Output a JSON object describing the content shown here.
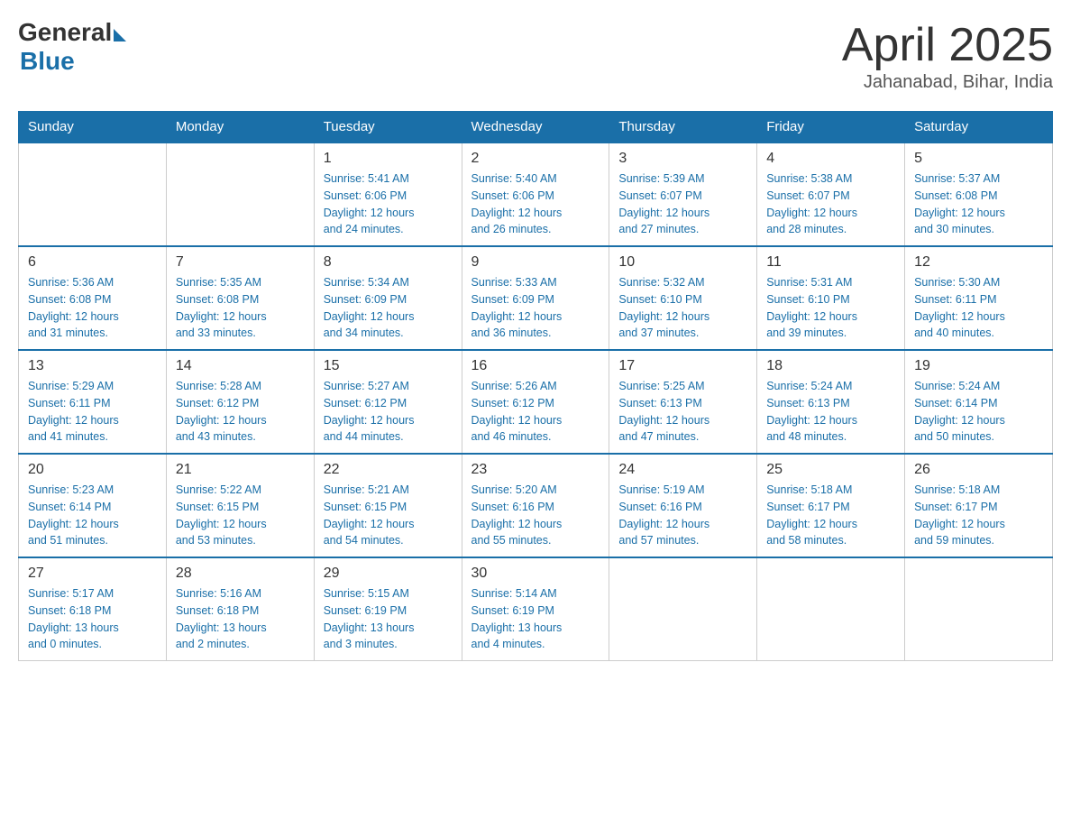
{
  "header": {
    "logo_general": "General",
    "logo_blue": "Blue",
    "month_title": "April 2025",
    "location": "Jahanabad, Bihar, India"
  },
  "weekdays": [
    "Sunday",
    "Monday",
    "Tuesday",
    "Wednesday",
    "Thursday",
    "Friday",
    "Saturday"
  ],
  "weeks": [
    [
      {
        "day": "",
        "info": ""
      },
      {
        "day": "",
        "info": ""
      },
      {
        "day": "1",
        "info": "Sunrise: 5:41 AM\nSunset: 6:06 PM\nDaylight: 12 hours\nand 24 minutes."
      },
      {
        "day": "2",
        "info": "Sunrise: 5:40 AM\nSunset: 6:06 PM\nDaylight: 12 hours\nand 26 minutes."
      },
      {
        "day": "3",
        "info": "Sunrise: 5:39 AM\nSunset: 6:07 PM\nDaylight: 12 hours\nand 27 minutes."
      },
      {
        "day": "4",
        "info": "Sunrise: 5:38 AM\nSunset: 6:07 PM\nDaylight: 12 hours\nand 28 minutes."
      },
      {
        "day": "5",
        "info": "Sunrise: 5:37 AM\nSunset: 6:08 PM\nDaylight: 12 hours\nand 30 minutes."
      }
    ],
    [
      {
        "day": "6",
        "info": "Sunrise: 5:36 AM\nSunset: 6:08 PM\nDaylight: 12 hours\nand 31 minutes."
      },
      {
        "day": "7",
        "info": "Sunrise: 5:35 AM\nSunset: 6:08 PM\nDaylight: 12 hours\nand 33 minutes."
      },
      {
        "day": "8",
        "info": "Sunrise: 5:34 AM\nSunset: 6:09 PM\nDaylight: 12 hours\nand 34 minutes."
      },
      {
        "day": "9",
        "info": "Sunrise: 5:33 AM\nSunset: 6:09 PM\nDaylight: 12 hours\nand 36 minutes."
      },
      {
        "day": "10",
        "info": "Sunrise: 5:32 AM\nSunset: 6:10 PM\nDaylight: 12 hours\nand 37 minutes."
      },
      {
        "day": "11",
        "info": "Sunrise: 5:31 AM\nSunset: 6:10 PM\nDaylight: 12 hours\nand 39 minutes."
      },
      {
        "day": "12",
        "info": "Sunrise: 5:30 AM\nSunset: 6:11 PM\nDaylight: 12 hours\nand 40 minutes."
      }
    ],
    [
      {
        "day": "13",
        "info": "Sunrise: 5:29 AM\nSunset: 6:11 PM\nDaylight: 12 hours\nand 41 minutes."
      },
      {
        "day": "14",
        "info": "Sunrise: 5:28 AM\nSunset: 6:12 PM\nDaylight: 12 hours\nand 43 minutes."
      },
      {
        "day": "15",
        "info": "Sunrise: 5:27 AM\nSunset: 6:12 PM\nDaylight: 12 hours\nand 44 minutes."
      },
      {
        "day": "16",
        "info": "Sunrise: 5:26 AM\nSunset: 6:12 PM\nDaylight: 12 hours\nand 46 minutes."
      },
      {
        "day": "17",
        "info": "Sunrise: 5:25 AM\nSunset: 6:13 PM\nDaylight: 12 hours\nand 47 minutes."
      },
      {
        "day": "18",
        "info": "Sunrise: 5:24 AM\nSunset: 6:13 PM\nDaylight: 12 hours\nand 48 minutes."
      },
      {
        "day": "19",
        "info": "Sunrise: 5:24 AM\nSunset: 6:14 PM\nDaylight: 12 hours\nand 50 minutes."
      }
    ],
    [
      {
        "day": "20",
        "info": "Sunrise: 5:23 AM\nSunset: 6:14 PM\nDaylight: 12 hours\nand 51 minutes."
      },
      {
        "day": "21",
        "info": "Sunrise: 5:22 AM\nSunset: 6:15 PM\nDaylight: 12 hours\nand 53 minutes."
      },
      {
        "day": "22",
        "info": "Sunrise: 5:21 AM\nSunset: 6:15 PM\nDaylight: 12 hours\nand 54 minutes."
      },
      {
        "day": "23",
        "info": "Sunrise: 5:20 AM\nSunset: 6:16 PM\nDaylight: 12 hours\nand 55 minutes."
      },
      {
        "day": "24",
        "info": "Sunrise: 5:19 AM\nSunset: 6:16 PM\nDaylight: 12 hours\nand 57 minutes."
      },
      {
        "day": "25",
        "info": "Sunrise: 5:18 AM\nSunset: 6:17 PM\nDaylight: 12 hours\nand 58 minutes."
      },
      {
        "day": "26",
        "info": "Sunrise: 5:18 AM\nSunset: 6:17 PM\nDaylight: 12 hours\nand 59 minutes."
      }
    ],
    [
      {
        "day": "27",
        "info": "Sunrise: 5:17 AM\nSunset: 6:18 PM\nDaylight: 13 hours\nand 0 minutes."
      },
      {
        "day": "28",
        "info": "Sunrise: 5:16 AM\nSunset: 6:18 PM\nDaylight: 13 hours\nand 2 minutes."
      },
      {
        "day": "29",
        "info": "Sunrise: 5:15 AM\nSunset: 6:19 PM\nDaylight: 13 hours\nand 3 minutes."
      },
      {
        "day": "30",
        "info": "Sunrise: 5:14 AM\nSunset: 6:19 PM\nDaylight: 13 hours\nand 4 minutes."
      },
      {
        "day": "",
        "info": ""
      },
      {
        "day": "",
        "info": ""
      },
      {
        "day": "",
        "info": ""
      }
    ]
  ]
}
